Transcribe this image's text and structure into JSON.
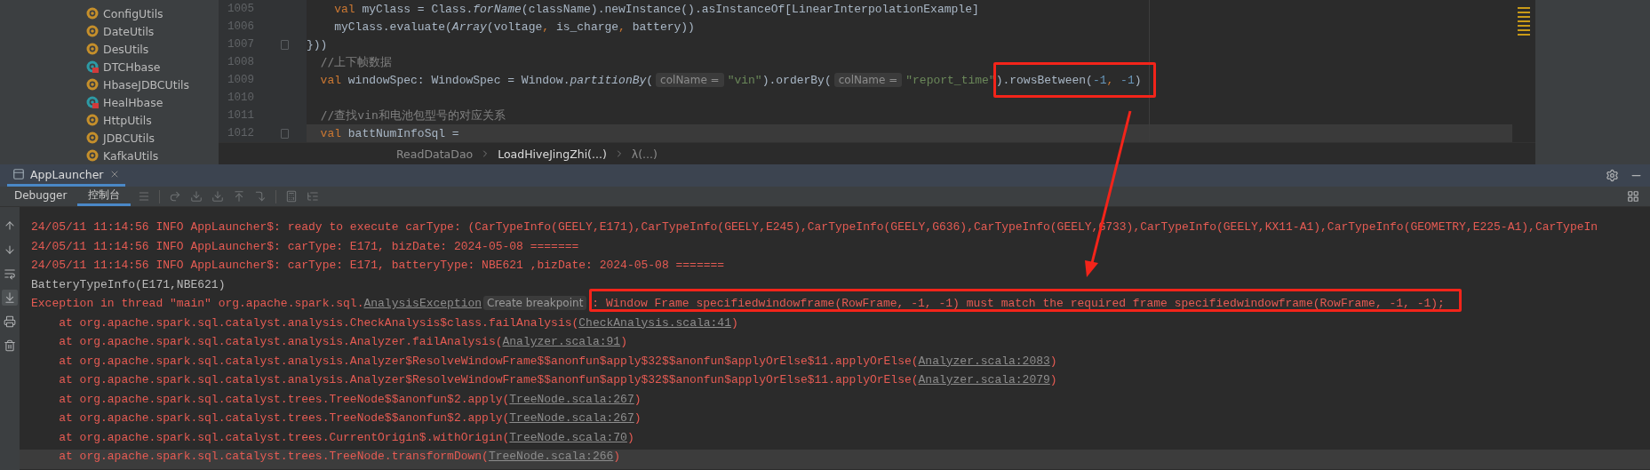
{
  "tree": {
    "items": [
      {
        "label": "ConfigUtils",
        "kind": "class"
      },
      {
        "label": "DateUtils",
        "kind": "class"
      },
      {
        "label": "DesUtils",
        "kind": "class"
      },
      {
        "label": "DTCHbase",
        "kind": "object"
      },
      {
        "label": "HbaseJDBCUtils",
        "kind": "class"
      },
      {
        "label": "HealHbase",
        "kind": "object"
      },
      {
        "label": "HttpUtils",
        "kind": "class"
      },
      {
        "label": "JDBCUtils",
        "kind": "class"
      },
      {
        "label": "KafkaUtils",
        "kind": "class"
      }
    ]
  },
  "editor": {
    "lines": [
      {
        "number": "1005",
        "fold_marker": false,
        "current": false,
        "tokens": [
          {
            "t": "    val",
            "kind": "keyword"
          },
          {
            "t": " myClass = Class.",
            "kind": "plain"
          },
          {
            "t": "forName",
            "kind": "italic"
          },
          {
            "t": "(className).newInstance().asInstanceOf[LinearInterpolationExample]",
            "kind": "plain"
          }
        ]
      },
      {
        "number": "1006",
        "fold_marker": false,
        "current": false,
        "tokens": [
          {
            "t": "    myClass.evaluate(",
            "kind": "plain"
          },
          {
            "t": "Array",
            "kind": "italic"
          },
          {
            "t": "(voltage",
            "kind": "plain"
          },
          {
            "t": ", ",
            "kind": "keyword"
          },
          {
            "t": "is_charge",
            "kind": "plain"
          },
          {
            "t": ", ",
            "kind": "keyword"
          },
          {
            "t": "battery))",
            "kind": "plain"
          }
        ]
      },
      {
        "number": "1007",
        "fold_marker": true,
        "current": false,
        "tokens": [
          {
            "t": "}))",
            "kind": "plain"
          }
        ]
      },
      {
        "number": "1008",
        "fold_marker": false,
        "current": false,
        "tokens": [
          {
            "t": "  //上下帧数据",
            "kind": "comment"
          }
        ]
      },
      {
        "number": "1009",
        "fold_marker": false,
        "current": false,
        "tokens": [
          {
            "t": "  val",
            "kind": "keyword"
          },
          {
            "t": " windowSpec: WindowSpec = Window.",
            "kind": "plain"
          },
          {
            "t": "partitionBy",
            "kind": "italic"
          },
          {
            "t": "(",
            "kind": "plain"
          },
          {
            "t": "colName =",
            "kind": "hint"
          },
          {
            "t": "\"vin\"",
            "kind": "string"
          },
          {
            "t": ").orderBy(",
            "kind": "plain"
          },
          {
            "t": "colName =",
            "kind": "hint"
          },
          {
            "t": "\"report_time\"",
            "kind": "string"
          },
          {
            "t": ").rowsBetween(",
            "kind": "plain",
            "boxed": true
          },
          {
            "t": "-1",
            "kind": "number",
            "boxed": true
          },
          {
            "t": ", ",
            "kind": "keyword",
            "boxed": true
          },
          {
            "t": "-1",
            "kind": "number",
            "boxed": true
          },
          {
            "t": ")",
            "kind": "plain",
            "boxed": true
          }
        ]
      },
      {
        "number": "1010",
        "fold_marker": false,
        "current": false
      },
      {
        "number": "1011",
        "fold_marker": false,
        "current": false,
        "tokens": [
          {
            "t": "  //查找vin和电池包型号的对应关系",
            "kind": "comment"
          }
        ]
      },
      {
        "number": "1012",
        "fold_marker": true,
        "current": true,
        "tokens": [
          {
            "t": "  val",
            "kind": "keyword"
          },
          {
            "t": " battNumInfoSql =",
            "kind": "plain"
          }
        ]
      }
    ]
  },
  "breadcrumb": [
    {
      "label": "ReadDataDao",
      "selected": false
    },
    {
      "label": "LoadHiveJingZhi(...)",
      "selected": true
    },
    {
      "label": "λ(...)",
      "selected": false
    }
  ],
  "run_panel": {
    "tab_title": "AppLauncher",
    "tabs": [
      {
        "label": "Debugger",
        "selected": false
      },
      {
        "label": "控制台",
        "selected": true
      }
    ],
    "lines": [
      {
        "kind": "stderr",
        "current": false,
        "segments": [
          {
            "t": "24/05/11 11:14:56 INFO AppLauncher$: ready to execute carType: (CarTypeInfo(GEELY,E171),CarTypeInfo(GEELY,E245),CarTypeInfo(GEELY,G636),CarTypeInfo(GEELY,G733),CarTypeInfo(GEELY,KX11-A1),CarTypeInfo(GEOMETRY,E225-A1),CarTypeIn",
            "kind": "text"
          }
        ]
      },
      {
        "kind": "stderr",
        "current": false,
        "segments": [
          {
            "t": "24/05/11 11:14:56 INFO AppLauncher$: carType: E171, bizDate: 2024-05-08 =======",
            "kind": "text"
          }
        ]
      },
      {
        "kind": "stderr",
        "current": false,
        "segments": [
          {
            "t": "24/05/11 11:14:56 INFO AppLauncher$: carType: E171, batteryType: NBE621 ,bizDate: 2024-05-08 =======",
            "kind": "text"
          }
        ]
      },
      {
        "kind": "stdout",
        "current": false,
        "segments": [
          {
            "t": "BatteryTypeInfo(E171,NBE621)",
            "kind": "text"
          }
        ]
      },
      {
        "kind": "stderr",
        "current": false,
        "segments": [
          {
            "t": "Exception in thread \"main\" org.apache.spark.sql.",
            "kind": "text"
          },
          {
            "t": "AnalysisException",
            "kind": "link"
          },
          {
            "t": "Create breakpoint",
            "kind": "hint"
          },
          {
            "t": ": Window Frame specifiedwindowframe(RowFrame, -1, -1) must match the required frame specifiedwindowframe(RowFrame, -1, -1);",
            "kind": "text",
            "boxed": true
          }
        ]
      },
      {
        "kind": "stderr",
        "current": false,
        "segments": [
          {
            "t": "    at org.apache.spark.sql.catalyst.analysis.CheckAnalysis$class.failAnalysis(",
            "kind": "text"
          },
          {
            "t": "CheckAnalysis.scala:41",
            "kind": "link"
          },
          {
            "t": ")",
            "kind": "text"
          }
        ]
      },
      {
        "kind": "stderr",
        "current": false,
        "segments": [
          {
            "t": "    at org.apache.spark.sql.catalyst.analysis.Analyzer.failAnalysis(",
            "kind": "text"
          },
          {
            "t": "Analyzer.scala:91",
            "kind": "link"
          },
          {
            "t": ")",
            "kind": "text"
          }
        ]
      },
      {
        "kind": "stderr",
        "current": false,
        "segments": [
          {
            "t": "    at org.apache.spark.sql.catalyst.analysis.Analyzer$ResolveWindowFrame$$anonfun$apply$32$$anonfun$applyOrElse$11.applyOrElse(",
            "kind": "text"
          },
          {
            "t": "Analyzer.scala:2083",
            "kind": "link"
          },
          {
            "t": ")",
            "kind": "text"
          }
        ]
      },
      {
        "kind": "stderr",
        "current": false,
        "segments": [
          {
            "t": "    at org.apache.spark.sql.catalyst.analysis.Analyzer$ResolveWindowFrame$$anonfun$apply$32$$anonfun$applyOrElse$11.applyOrElse(",
            "kind": "text"
          },
          {
            "t": "Analyzer.scala:2079",
            "kind": "link"
          },
          {
            "t": ")",
            "kind": "text"
          }
        ]
      },
      {
        "kind": "stderr",
        "current": false,
        "segments": [
          {
            "t": "    at org.apache.spark.sql.catalyst.trees.TreeNode$$anonfun$2.apply(",
            "kind": "text"
          },
          {
            "t": "TreeNode.scala:267",
            "kind": "link"
          },
          {
            "t": ")",
            "kind": "text"
          }
        ]
      },
      {
        "kind": "stderr",
        "current": false,
        "segments": [
          {
            "t": "    at org.apache.spark.sql.catalyst.trees.TreeNode$$anonfun$2.apply(",
            "kind": "text"
          },
          {
            "t": "TreeNode.scala:267",
            "kind": "link"
          },
          {
            "t": ")",
            "kind": "text"
          }
        ]
      },
      {
        "kind": "stderr",
        "current": false,
        "segments": [
          {
            "t": "    at org.apache.spark.sql.catalyst.trees.CurrentOrigin$.withOrigin(",
            "kind": "text"
          },
          {
            "t": "TreeNode.scala:70",
            "kind": "link"
          },
          {
            "t": ")",
            "kind": "text"
          }
        ]
      },
      {
        "kind": "stderr",
        "current": true,
        "segments": [
          {
            "t": "    at org.apache.spark.sql.catalyst.trees.TreeNode.transformDown(",
            "kind": "text"
          },
          {
            "t": "TreeNode.scala:266",
            "kind": "link"
          },
          {
            "t": ")",
            "kind": "text"
          }
        ]
      }
    ]
  }
}
